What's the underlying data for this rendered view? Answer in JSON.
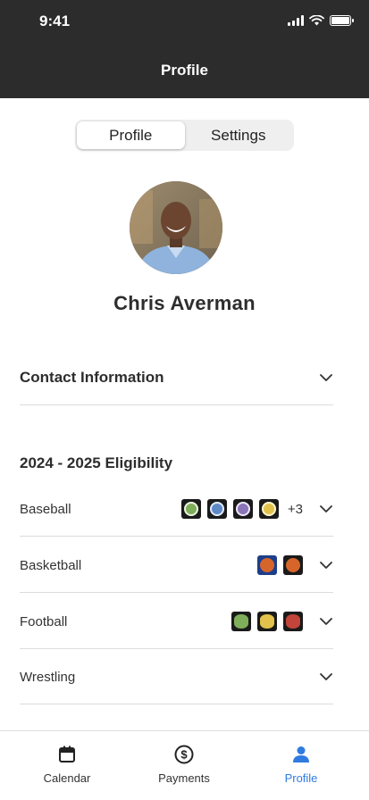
{
  "status_bar": {
    "time": "9:41"
  },
  "header": {
    "title": "Profile"
  },
  "segments": [
    {
      "label": "Profile",
      "active": true
    },
    {
      "label": "Settings",
      "active": false
    }
  ],
  "profile": {
    "name": "Chris Averman"
  },
  "contact": {
    "label": "Contact Information"
  },
  "eligibility": {
    "heading": "2024 - 2025 Eligibility",
    "sports": [
      {
        "label": "Baseball",
        "badges": [
          "baseball-green",
          "baseball-blue",
          "baseball-purple",
          "baseball-yellow"
        ],
        "more": "+3"
      },
      {
        "label": "Basketball",
        "badges": [
          "basketball-blue",
          "basketball-orange"
        ],
        "more": ""
      },
      {
        "label": "Football",
        "badges": [
          "football-green",
          "football-yellow",
          "football-red"
        ],
        "more": ""
      },
      {
        "label": "Wrestling",
        "badges": [],
        "more": ""
      }
    ]
  },
  "tabs": [
    {
      "label": "Calendar",
      "icon": "calendar-icon",
      "active": false
    },
    {
      "label": "Payments",
      "icon": "dollar-circle-icon",
      "active": false
    },
    {
      "label": "Profile",
      "icon": "person-icon",
      "active": true
    }
  ],
  "colors": {
    "header_bg": "#2c2c2c",
    "accent": "#2f7be0",
    "badge_green": "#7fae5a",
    "badge_blue": "#5d89c7",
    "badge_purple": "#8b74b8",
    "badge_yellow": "#e2c24a",
    "badge_orange": "#d6652b",
    "badge_red": "#c2443a"
  }
}
